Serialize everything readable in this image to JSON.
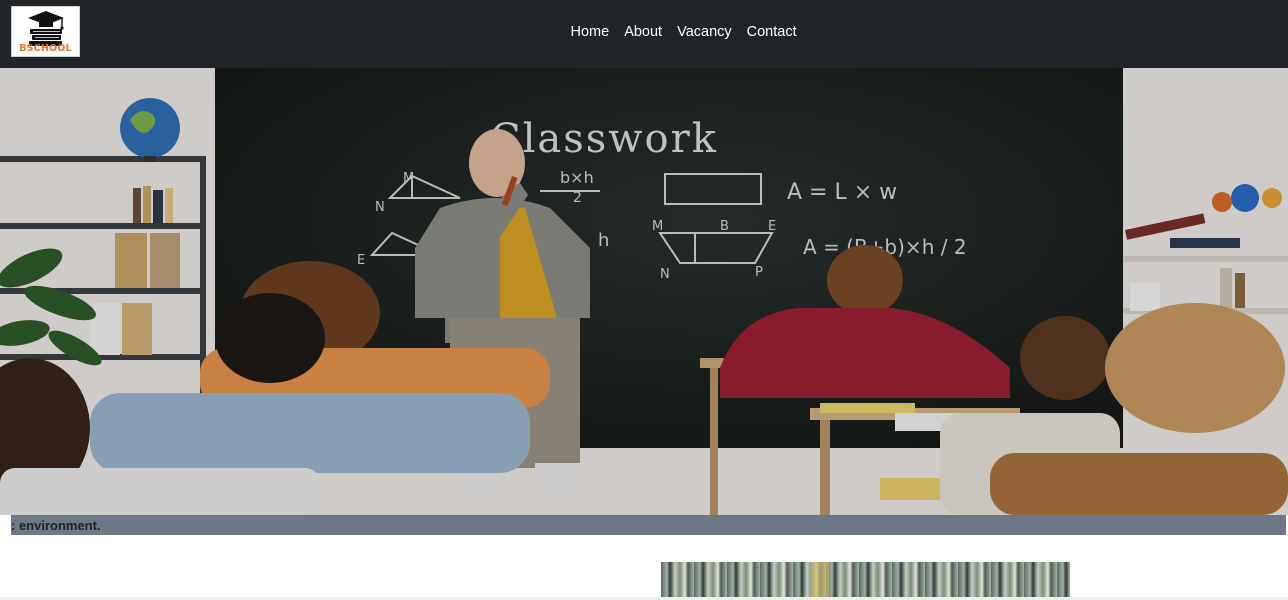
{
  "brand": {
    "logo_text": "BSCHOOL",
    "logo_icon": "graduation-cap-books-icon",
    "logo_text_color": "#e8742a"
  },
  "nav": {
    "items": [
      {
        "label": "Home"
      },
      {
        "label": "About"
      },
      {
        "label": "Vacancy"
      },
      {
        "label": "Contact"
      }
    ]
  },
  "hero": {
    "image": "classroom-teacher-photo",
    "chalkboard_heading": "Classwork",
    "formula_1": "A = L × w",
    "formula_2": "A = (B+b)×h / 2"
  },
  "caption": {
    "text": ": environment."
  },
  "colors": {
    "navbar_bg": "#212529",
    "caption_bg": "#6e7785"
  }
}
